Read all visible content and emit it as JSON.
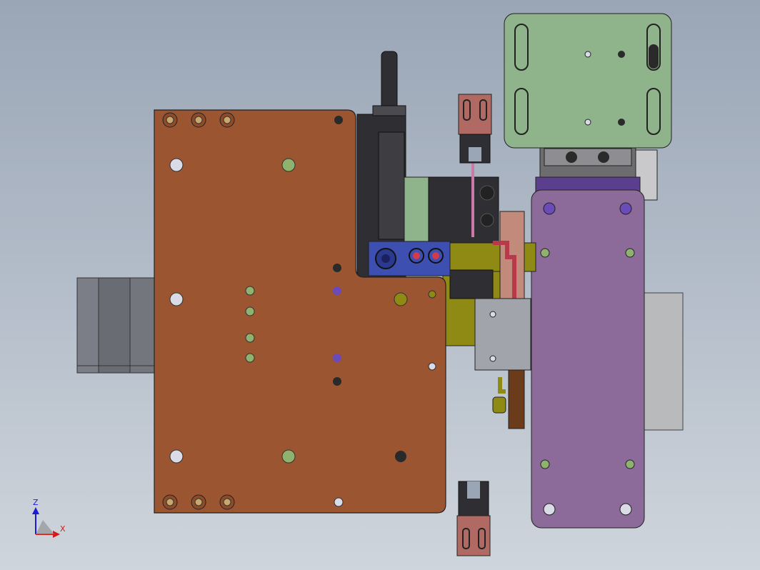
{
  "viewport": {
    "background_top": "#9aa6b6",
    "background_bottom": "#cfd5dc"
  },
  "colors": {
    "main_plate": "#9b5531",
    "green_plate": "#8fb38a",
    "purple_plate": "#8c6a9a",
    "blue_block": "#3d4fb0",
    "olive_block": "#8f8a14",
    "motor_grey": "#6e7078",
    "pink_plate": "#b06a63",
    "dark_body": "#2f2f33",
    "hole_light": "#d9dbe6",
    "hole_green": "#8fb36f",
    "hole_purple": "#6a4bb8",
    "screw_gold": "#c9a86b",
    "axis_z": "#1b1bd6",
    "axis_x": "#d11b1b"
  },
  "triad": {
    "z_label": "Z",
    "x_label": "X"
  }
}
